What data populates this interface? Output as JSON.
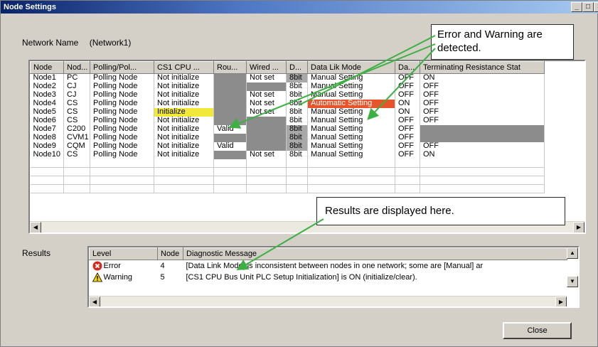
{
  "window": {
    "title": "Node Settings"
  },
  "network": {
    "label": "Network Name",
    "value": "(Network1)"
  },
  "grid": {
    "columns": [
      "Node",
      "Nod...",
      "Polling/Pol...",
      "CS1 CPU ...",
      "Rou...",
      "Wired ...",
      "D...",
      "Data Lik Mode",
      "Da...",
      "Terminating Resistance Stat"
    ],
    "rows": [
      {
        "node": "Node1",
        "type": "PC",
        "polling": "Polling Node",
        "cs1": "Not initialize",
        "rou": "",
        "wired": "Not set",
        "d": "8bit",
        "mode": "Manual Setting",
        "da": "OFF",
        "term": "ON"
      },
      {
        "node": "Node2",
        "type": "CJ",
        "polling": "Polling Node",
        "cs1": "Not initialize",
        "rou": "",
        "wired": "",
        "d": "8bit",
        "mode": "Manual Setting",
        "da": "OFF",
        "term": "OFF"
      },
      {
        "node": "Node3",
        "type": "CJ",
        "polling": "Polling Node",
        "cs1": "Not initialize",
        "rou": "",
        "wired": "Not set",
        "d": "8bit",
        "mode": "Manual Setting",
        "da": "OFF",
        "term": "OFF"
      },
      {
        "node": "Node4",
        "type": "CS",
        "polling": "Polling Node",
        "cs1": "Not initialize",
        "rou": "",
        "wired": "Not set",
        "d": "8bit",
        "mode": "Automatic Setting",
        "da": "ON",
        "term": "OFF"
      },
      {
        "node": "Node5",
        "type": "CS",
        "polling": "Polling Node",
        "cs1": "Initialize",
        "rou": "",
        "wired": "Not set",
        "d": "8bit",
        "mode": "Manual Setting",
        "da": "ON",
        "term": "OFF"
      },
      {
        "node": "Node6",
        "type": "CS",
        "polling": "Polling Node",
        "cs1": "Not initialize",
        "rou": "",
        "wired": "",
        "d": "8bit",
        "mode": "Manual Setting",
        "da": "OFF",
        "term": "OFF"
      },
      {
        "node": "Node7",
        "type": "C200",
        "polling": "Polling Node",
        "cs1": "Not initialize",
        "rou": "Valid",
        "wired": "",
        "d": "8bit",
        "mode": "Manual Setting",
        "da": "OFF",
        "term": ""
      },
      {
        "node": "Node8",
        "type": "CVM1",
        "polling": "Polling Node",
        "cs1": "Not initialize",
        "rou": "",
        "wired": "",
        "d": "8bit",
        "mode": "Manual Setting",
        "da": "OFF",
        "term": ""
      },
      {
        "node": "Node9",
        "type": "CQM",
        "polling": "Polling Node",
        "cs1": "Not initialize",
        "rou": "Valid",
        "wired": "",
        "d": "8bit",
        "mode": "Manual Setting",
        "da": "OFF",
        "term": "OFF"
      },
      {
        "node": "Node10",
        "type": "CS",
        "polling": "Polling Node",
        "cs1": "Not initialize",
        "rou": "",
        "wired": "Not set",
        "d": "8bit",
        "mode": "Manual Setting",
        "da": "OFF",
        "term": "ON"
      }
    ]
  },
  "results": {
    "label": "Results",
    "columns": [
      "Level",
      "Node",
      "Diagnostic Message"
    ],
    "rows": [
      {
        "level": "Error",
        "icon": "error-icon",
        "node": "4",
        "message": "[Data Link Mode] is inconsistent between nodes in one network; some are [Manual] ar"
      },
      {
        "level": "Warning",
        "icon": "warning-icon",
        "node": "5",
        "message": "[CS1 CPU Bus Unit PLC Setup Initialization] is ON (initialize/clear)."
      }
    ]
  },
  "buttons": {
    "close": "Close"
  },
  "callouts": {
    "errors": "Error and Warning are detected.",
    "results": "Results are displayed here."
  },
  "colors": {
    "error_cell": "#e8542a",
    "warning_cell": "#f2e83a",
    "disabled_cell": "#8c8c8c",
    "arrow": "#3cb043"
  }
}
